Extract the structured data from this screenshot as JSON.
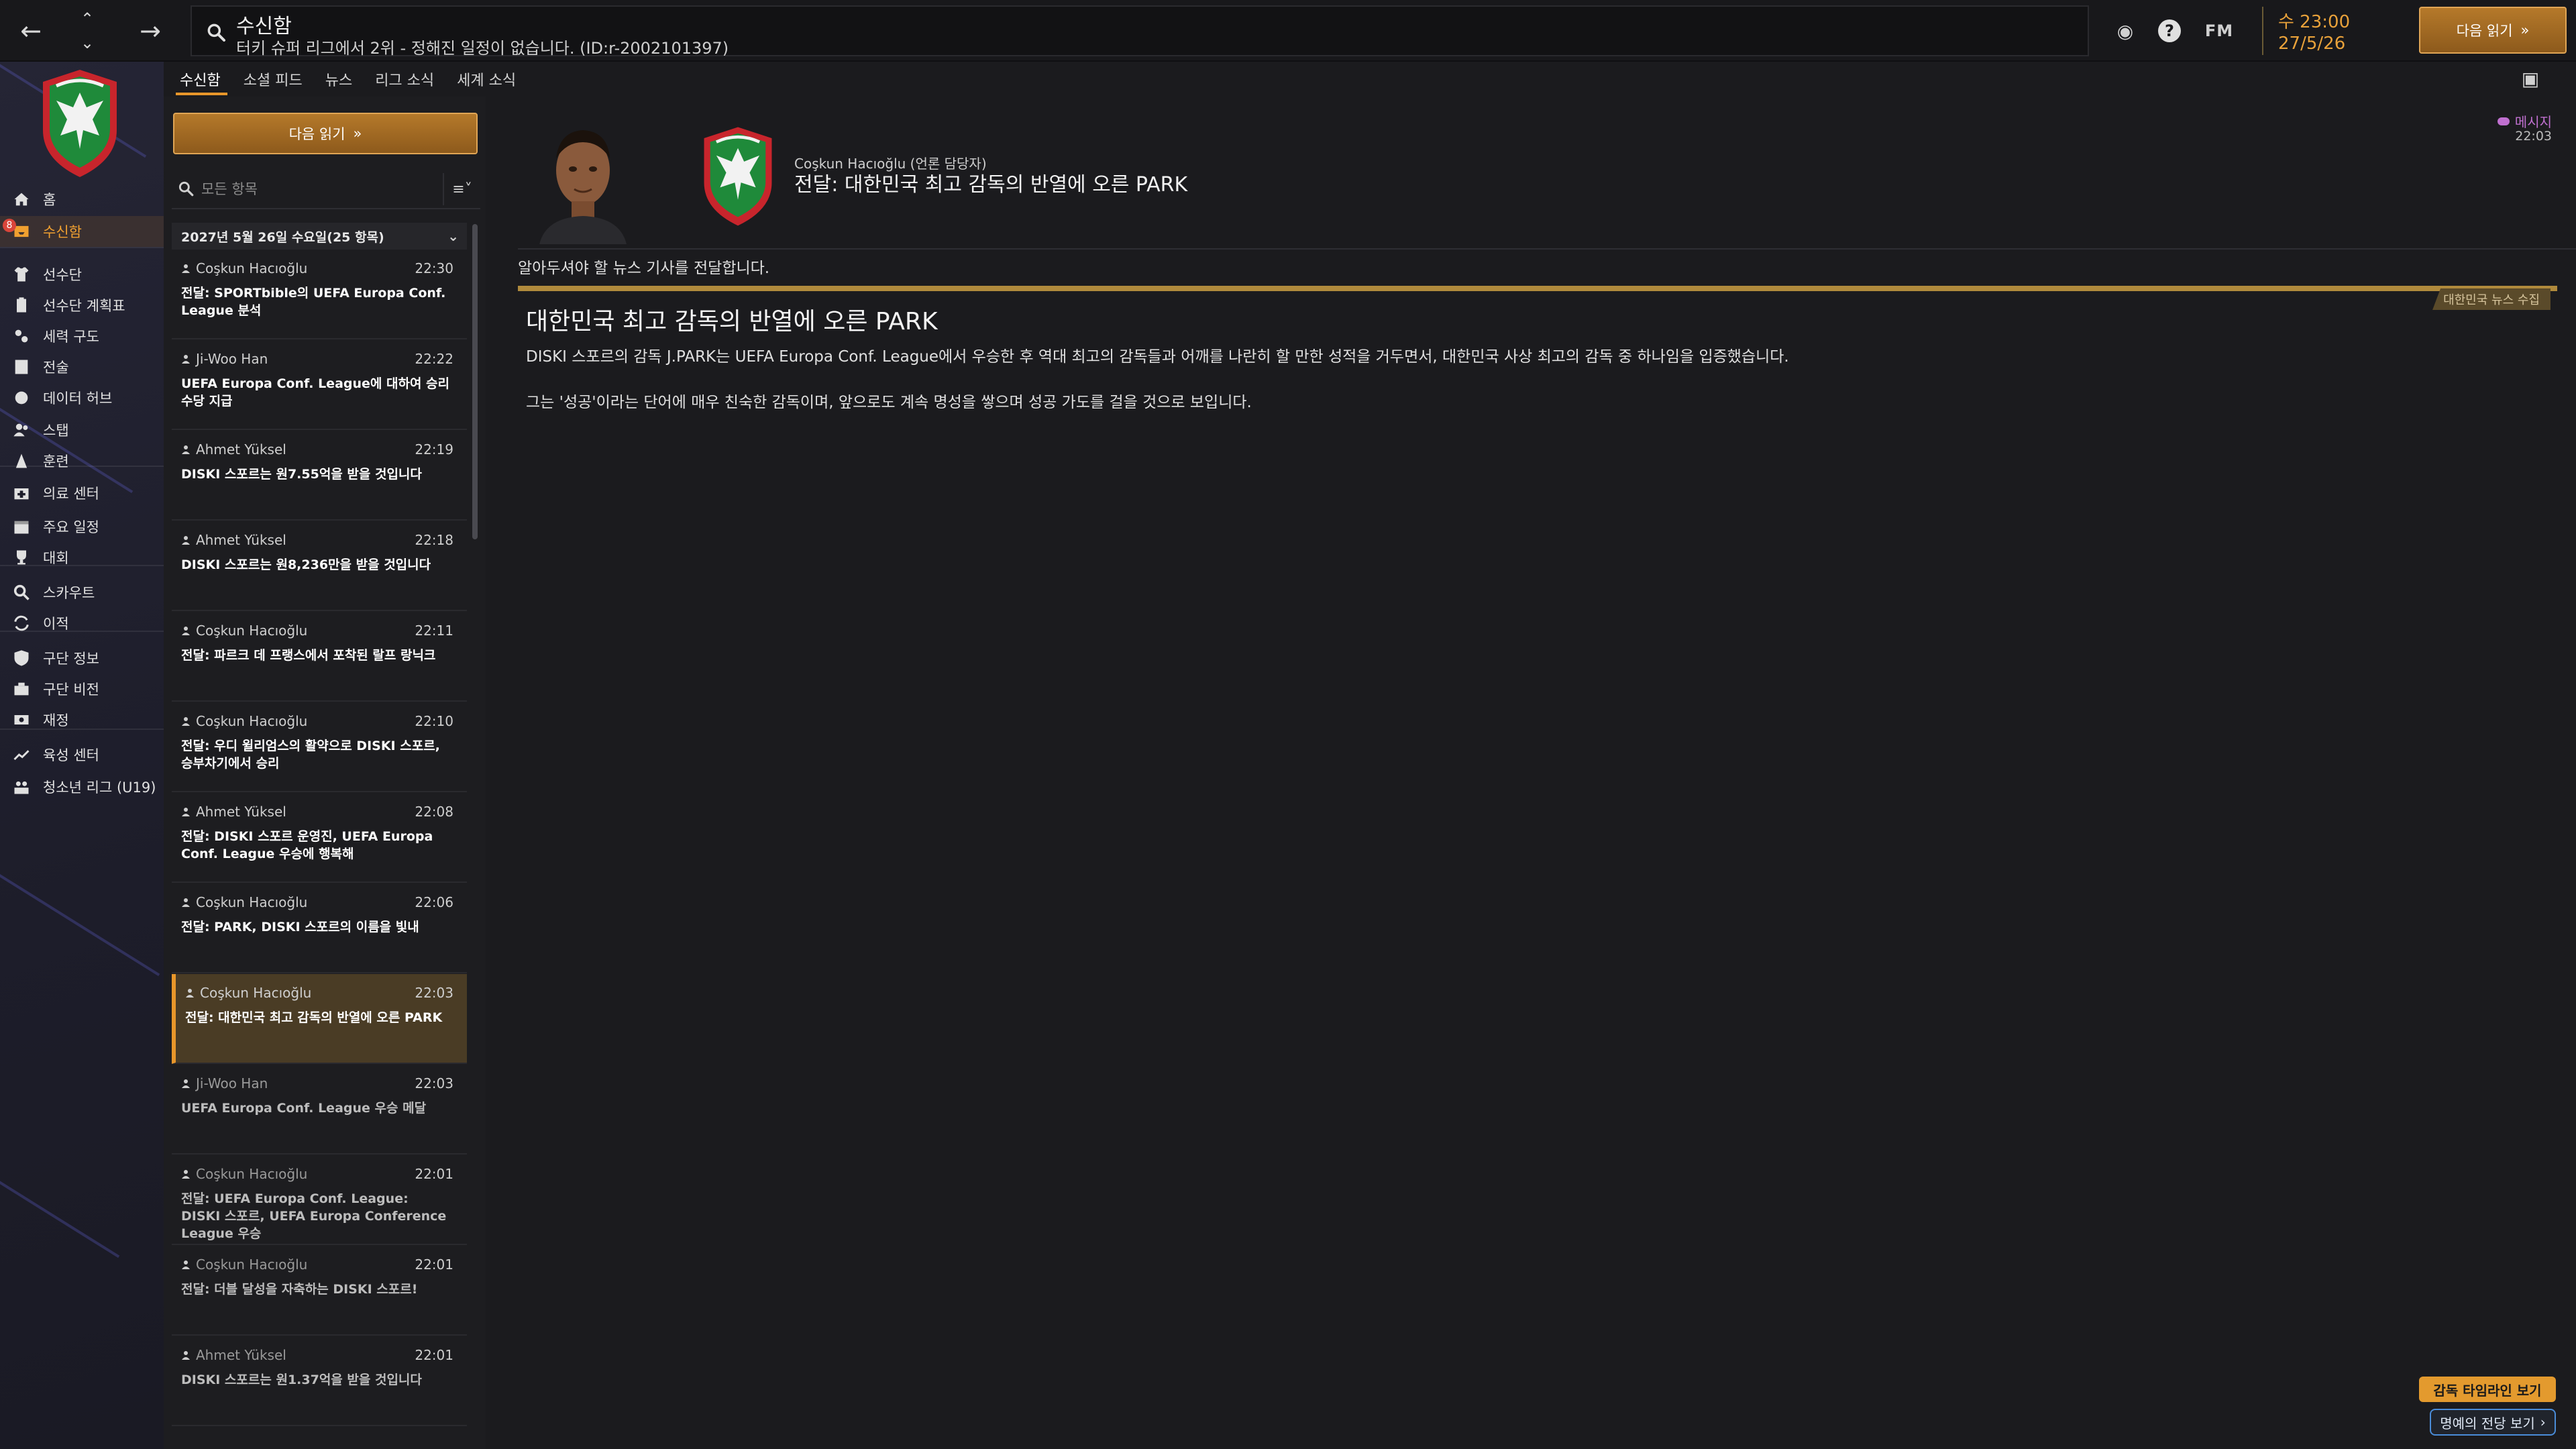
{
  "topbar": {
    "title": "수신함",
    "subtitle": "터키 슈퍼 리그에서 2위 - 정해진 일정이 없습니다. (ID:r-2002101397)",
    "icons": [
      "back-arrow-icon",
      "up-chevron-icon",
      "down-chevron-icon",
      "forward-arrow-icon",
      "search-icon",
      "globe-icon",
      "help-icon"
    ],
    "fm_label": "FM",
    "time": "수 23:00",
    "date": "27/5/26",
    "continue_label": "다음 읽기"
  },
  "sidebar": {
    "badge": "8",
    "items": [
      {
        "label": "홈",
        "icon": "home-icon"
      },
      {
        "label": "수신함",
        "icon": "inbox-icon",
        "active": true
      },
      {
        "label": "선수단",
        "icon": "shirt-icon"
      },
      {
        "label": "선수단 계획표",
        "icon": "clipboard-icon"
      },
      {
        "label": "세력 구도",
        "icon": "dynamics-icon"
      },
      {
        "label": "전술",
        "icon": "tactics-icon"
      },
      {
        "label": "데이터 허브",
        "icon": "data-hub-icon"
      },
      {
        "label": "스탭",
        "icon": "staff-icon"
      },
      {
        "label": "훈련",
        "icon": "training-icon"
      },
      {
        "label": "의료 센터",
        "icon": "medical-icon"
      },
      {
        "label": "주요 일정",
        "icon": "calendar-icon"
      },
      {
        "label": "대회",
        "icon": "trophy-icon"
      },
      {
        "label": "스카우트",
        "icon": "scout-icon"
      },
      {
        "label": "이적",
        "icon": "transfer-icon"
      },
      {
        "label": "구단 정보",
        "icon": "club-info-icon"
      },
      {
        "label": "구단 비전",
        "icon": "club-vision-icon"
      },
      {
        "label": "재정",
        "icon": "finance-icon"
      },
      {
        "label": "육성 센터",
        "icon": "development-icon"
      },
      {
        "label": "청소년 리그 (U19)",
        "icon": "youth-icon"
      }
    ]
  },
  "tabs": [
    "수신함",
    "소셜 피드",
    "뉴스",
    "리그 소식",
    "세계 소식"
  ],
  "list": {
    "continue_label": "다음 읽기",
    "filter_placeholder": "모든 항목",
    "date_header": "2027년 5월 26일 수요일(25 항목)",
    "messages": [
      {
        "sender": "Coşkun Hacıoğlu",
        "time": "22:30",
        "subject": "전달: SPORTbible의 UEFA Europa Conf. League 분석",
        "read": false
      },
      {
        "sender": "Ji-Woo Han",
        "time": "22:22",
        "subject": "UEFA Europa Conf. League에 대하여 승리 수당 지급",
        "read": false
      },
      {
        "sender": "Ahmet Yüksel",
        "time": "22:19",
        "subject": "DISKI 스포르는 원7.55억을 받을 것입니다",
        "read": false
      },
      {
        "sender": "Ahmet Yüksel",
        "time": "22:18",
        "subject": "DISKI 스포르는 원8,236만을 받을 것입니다",
        "read": false
      },
      {
        "sender": "Coşkun Hacıoğlu",
        "time": "22:11",
        "subject": "전달: 파르크 데 프랭스에서 포착된 랄프 랑닉크",
        "read": false
      },
      {
        "sender": "Coşkun Hacıoğlu",
        "time": "22:10",
        "subject": "전달: 우디 윌리엄스의 활약으로 DISKI 스포르, 승부차기에서 승리",
        "read": false
      },
      {
        "sender": "Ahmet Yüksel",
        "time": "22:08",
        "subject": "전달: DISKI 스포르 운영진, UEFA Europa Conf. League 우승에 행복해",
        "read": false
      },
      {
        "sender": "Coşkun Hacıoğlu",
        "time": "22:06",
        "subject": "전달: PARK, DISKI 스포르의 이름을 빛내",
        "read": false
      },
      {
        "sender": "Coşkun Hacıoğlu",
        "time": "22:03",
        "subject": "전달: 대한민국 최고 감독의 반열에 오른 PARK",
        "read": false,
        "selected": true
      },
      {
        "sender": "Ji-Woo Han",
        "time": "22:03",
        "subject": "UEFA Europa Conf. League 우승 메달",
        "read": true
      },
      {
        "sender": "Coşkun Hacıoğlu",
        "time": "22:01",
        "subject": "전달: UEFA Europa Conf. League: DISKI 스포르, UEFA Europa Conference League 우승",
        "read": true
      },
      {
        "sender": "Coşkun Hacıoğlu",
        "time": "22:01",
        "subject": "전달: 더블 달성을 자축하는 DISKI 스포르!",
        "read": true
      },
      {
        "sender": "Ahmet Yüksel",
        "time": "22:01",
        "subject": "DISKI 스포르는 원1.37억을 받을 것입니다",
        "read": true
      }
    ]
  },
  "view": {
    "sender": "Coşkun Hacıoğlu (언론 담당자)",
    "subject": "전달: 대한민국 최고 감독의 반열에 오른 PARK",
    "type_label": "메시지",
    "time": "22:03",
    "intro": "알아두셔야 할 뉴스 기사를 전달합니다.",
    "news_tag": "대한민국 뉴스 수집",
    "headline": "대한민국 최고 감독의 반열에 오른 PARK",
    "paragraph1": "DISKI 스포르의 감독 J.PARK는 UEFA Europa Conf. League에서 우승한 후 역대 최고의 감독들과 어깨를 나란히 할 만한 성적을 거두면서, 대한민국 사상 최고의 감독 중 하나임을 입증했습니다.",
    "paragraph2": "그는 '성공'이라는 단어에 매우 친숙한 감독이며, 앞으로도 계속 명성을 쌓으며 성공 가도를 걸을 것으로 보입니다."
  },
  "bottom": {
    "timeline_label": "감독 타임라인 보기",
    "hof_label": "명예의 전당 보기"
  },
  "colors": {
    "accent": "#e8962a",
    "selected_row": "#4a3c25",
    "news_bar": "#b08a3c",
    "message_type": "#c070d0"
  }
}
